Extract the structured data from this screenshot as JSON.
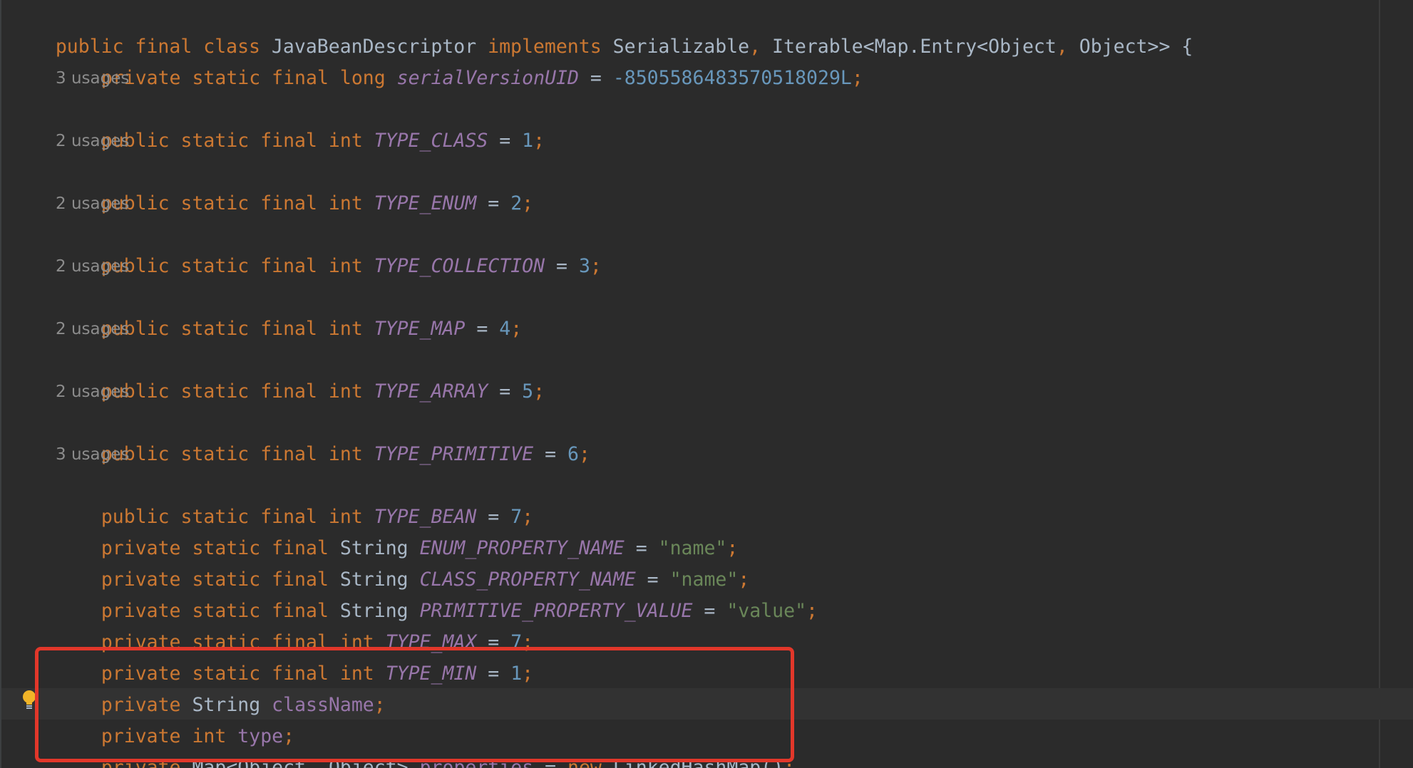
{
  "editor": {
    "usage_hints": {
      "type_class": "3 usages",
      "type_enum": "2 usages",
      "type_collection": "2 usages",
      "type_map": "2 usages",
      "type_array": "2 usages",
      "type_primitive": "2 usages",
      "type_bean": "3 usages"
    },
    "lines": {
      "l1": {
        "kw1": "public final class ",
        "cls": "JavaBeanDescriptor ",
        "kw2": "implements ",
        "t1": "Serializable",
        "c1": ", ",
        "t2": "Iterable<Map.Entry<Object",
        "c2": ", ",
        "t3": "Object>> {"
      },
      "l2": {
        "kw": "private static final long ",
        "name": "serialVersionUID",
        "eq": " = ",
        "val": "-8505586483570518029L",
        "semi": ";"
      },
      "l3": {
        "kw": "public static final int ",
        "name": "TYPE_CLASS",
        "eq": " = ",
        "val": "1",
        "semi": ";"
      },
      "l4": {
        "kw": "public static final int ",
        "name": "TYPE_ENUM",
        "eq": " = ",
        "val": "2",
        "semi": ";"
      },
      "l5": {
        "kw": "public static final int ",
        "name": "TYPE_COLLECTION",
        "eq": " = ",
        "val": "3",
        "semi": ";"
      },
      "l6": {
        "kw": "public static final int ",
        "name": "TYPE_MAP",
        "eq": " = ",
        "val": "4",
        "semi": ";"
      },
      "l7": {
        "kw": "public static final int ",
        "name": "TYPE_ARRAY",
        "eq": " = ",
        "val": "5",
        "semi": ";"
      },
      "l8": {
        "kw": "public static final int ",
        "name": "TYPE_PRIMITIVE",
        "eq": " = ",
        "val": "6",
        "semi": ";"
      },
      "l9": {
        "kw": "public static final int ",
        "name": "TYPE_BEAN",
        "eq": " = ",
        "val": "7",
        "semi": ";"
      },
      "l10": {
        "kw": "private static final ",
        "type": "String ",
        "name": "ENUM_PROPERTY_NAME",
        "eq": " = ",
        "val": "\"name\"",
        "semi": ";"
      },
      "l11": {
        "kw": "private static final ",
        "type": "String ",
        "name": "CLASS_PROPERTY_NAME",
        "eq": " = ",
        "val": "\"name\"",
        "semi": ";"
      },
      "l12": {
        "kw": "private static final ",
        "type": "String ",
        "name": "PRIMITIVE_PROPERTY_VALUE",
        "eq": " = ",
        "val": "\"value\"",
        "semi": ";"
      },
      "l13": {
        "kw": "private static final int ",
        "name": "TYPE_MAX",
        "eq": " = ",
        "val": "7",
        "semi": ";"
      },
      "l14": {
        "kw": "private static final int ",
        "name": "TYPE_MIN",
        "eq": " = ",
        "val": "1",
        "semi": ";"
      },
      "l15": {
        "kw": "private ",
        "type": "String ",
        "name": "className",
        "semi": ";"
      },
      "l16": {
        "kw": "private int ",
        "name": "type",
        "semi": ";"
      },
      "l17": {
        "kw": "private ",
        "t1": "Map<Object",
        "c1": ", ",
        "t2": "Object> ",
        "name": "properties",
        "eq": " = ",
        "kw2": "new ",
        "ctor": "LinkedHashMap()",
        "semi": ";"
      }
    }
  },
  "colors": {
    "background": "#2b2b2b",
    "keyword": "#cc7832",
    "constant": "#9876aa",
    "number": "#6897bb",
    "string": "#6a8759",
    "text": "#a9b7c6",
    "highlight_box": "#e2372a",
    "bulb": "#f0b428"
  }
}
